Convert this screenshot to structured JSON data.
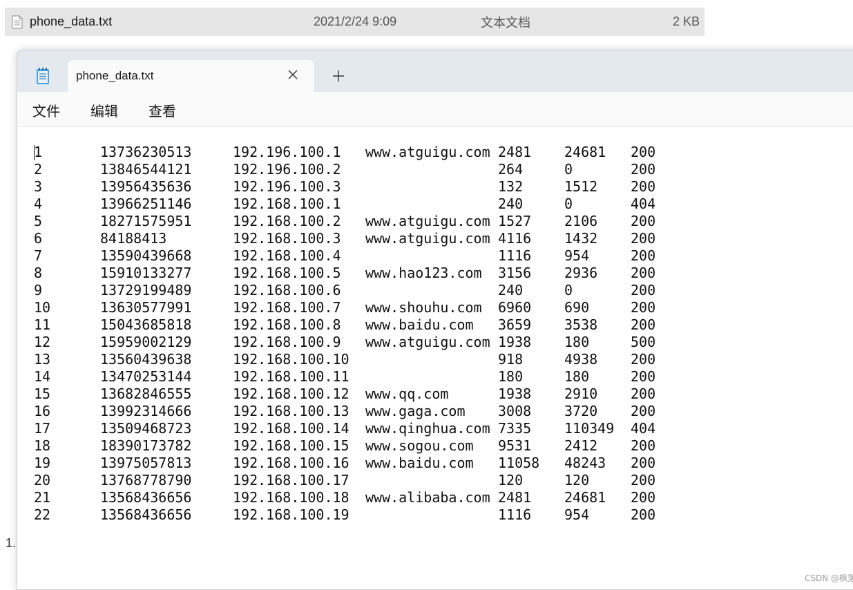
{
  "explorer": {
    "file_name": "phone_data.txt",
    "date": "2021/2/24 9:09",
    "type": "文本文档",
    "size": "2 KB",
    "left_fragment": "1."
  },
  "notepad": {
    "tab_title": "phone_data.txt",
    "menu": {
      "file": "文件",
      "edit": "编辑",
      "view": "查看"
    },
    "rows": [
      [
        "1",
        "13736230513",
        "192.196.100.1",
        "www.atguigu.com",
        "2481",
        "24681",
        "200"
      ],
      [
        "2",
        "13846544121",
        "192.196.100.2",
        "",
        "264",
        "0",
        "200"
      ],
      [
        "3",
        "13956435636",
        "192.196.100.3",
        "",
        "132",
        "1512",
        "200"
      ],
      [
        "4",
        "13966251146",
        "192.168.100.1",
        "",
        "240",
        "0",
        "404"
      ],
      [
        "5",
        "18271575951",
        "192.168.100.2",
        "www.atguigu.com",
        "1527",
        "2106",
        "200"
      ],
      [
        "6",
        "84188413",
        "192.168.100.3",
        "www.atguigu.com",
        "4116",
        "1432",
        "200"
      ],
      [
        "7",
        "13590439668",
        "192.168.100.4",
        "",
        "1116",
        "954",
        "200"
      ],
      [
        "8",
        "15910133277",
        "192.168.100.5",
        "www.hao123.com",
        "3156",
        "2936",
        "200"
      ],
      [
        "9",
        "13729199489",
        "192.168.100.6",
        "",
        "240",
        "0",
        "200"
      ],
      [
        "10",
        "13630577991",
        "192.168.100.7",
        "www.shouhu.com",
        "6960",
        "690",
        "200"
      ],
      [
        "11",
        "15043685818",
        "192.168.100.8",
        "www.baidu.com",
        "3659",
        "3538",
        "200"
      ],
      [
        "12",
        "15959002129",
        "192.168.100.9",
        "www.atguigu.com",
        "1938",
        "180",
        "500"
      ],
      [
        "13",
        "13560439638",
        "192.168.100.10",
        "",
        "918",
        "4938",
        "200"
      ],
      [
        "14",
        "13470253144",
        "192.168.100.11",
        "",
        "180",
        "180",
        "200"
      ],
      [
        "15",
        "13682846555",
        "192.168.100.12",
        "www.qq.com",
        "1938",
        "2910",
        "200"
      ],
      [
        "16",
        "13992314666",
        "192.168.100.13",
        "www.gaga.com",
        "3008",
        "3720",
        "200"
      ],
      [
        "17",
        "13509468723",
        "192.168.100.14",
        "www.qinghua.com",
        "7335",
        "110349",
        "404"
      ],
      [
        "18",
        "18390173782",
        "192.168.100.15",
        "www.sogou.com",
        "9531",
        "2412",
        "200"
      ],
      [
        "19",
        "13975057813",
        "192.168.100.16",
        "www.baidu.com",
        "11058",
        "48243",
        "200"
      ],
      [
        "20",
        "13768778790",
        "192.168.100.17",
        "",
        "120",
        "120",
        "200"
      ],
      [
        "21",
        "13568436656",
        "192.168.100.18",
        "www.alibaba.com",
        "2481",
        "24681",
        "200"
      ],
      [
        "22",
        "13568436656",
        "192.168.100.19",
        "",
        "1116",
        "954",
        "200"
      ]
    ]
  },
  "watermark": "CSDN @枫落@"
}
